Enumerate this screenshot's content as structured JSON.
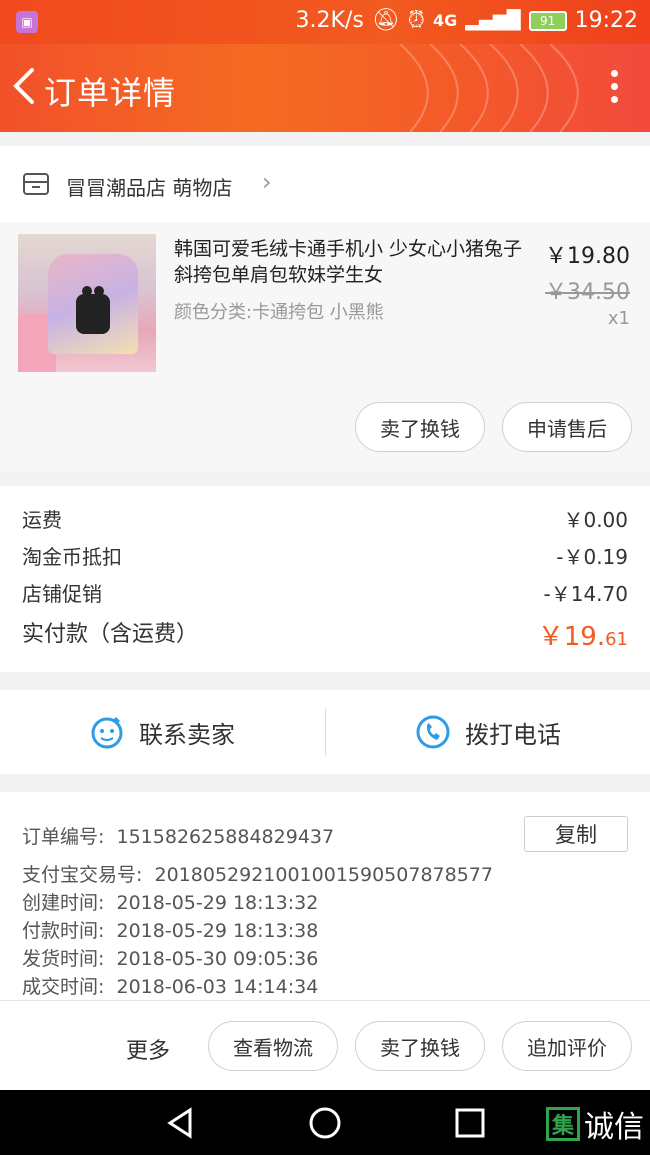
{
  "status_bar": {
    "net_speed": "3.2K/s",
    "network": "4G",
    "battery": "91",
    "time": "19:22"
  },
  "app_bar": {
    "title": "订单详情"
  },
  "shop": {
    "name": "冒冒潮品店 萌物店"
  },
  "product": {
    "title": "韩国可爱毛绒卡通手机小 少女心小猪兔子斜挎包单肩包软妹学生女",
    "spec": "颜色分类:卡通挎包 小黑熊",
    "price": "￥19.80",
    "original_price": "￥34.50",
    "quantity": "x1",
    "actions": [
      "卖了换钱",
      "申请售后"
    ]
  },
  "fees": {
    "shipping_label": "运费",
    "shipping_value": "￥0.00",
    "coin_label": "淘金币抵扣",
    "coin_value": "-￥0.19",
    "promo_label": "店铺促销",
    "promo_value": "-￥14.70",
    "total_label": "实付款（含运费）",
    "total_currency": "￥",
    "total_int": "19.",
    "total_dec": "61",
    "accent_color": "#f25a1f"
  },
  "contact": {
    "seller_label": "联系卖家",
    "phone_label": "拨打电话"
  },
  "order_info": {
    "copy_label": "复制",
    "rows": [
      {
        "label": "订单编号:",
        "value": "151582625884829437"
      },
      {
        "label": "支付宝交易号:",
        "value": "2018052921001001590507878577"
      },
      {
        "label": "创建时间:",
        "value": "2018-05-29 18:13:32"
      },
      {
        "label": "付款时间:",
        "value": "2018-05-29 18:13:38"
      },
      {
        "label": "发货时间:",
        "value": "2018-05-30 09:05:36"
      },
      {
        "label": "成交时间:",
        "value": "2018-06-03 14:14:34"
      }
    ]
  },
  "bottom_bar": {
    "more_label": "更多",
    "actions": [
      "查看物流",
      "卖了换钱",
      "追加评价"
    ]
  },
  "watermark": {
    "box_char": "集",
    "text": "诚信"
  }
}
